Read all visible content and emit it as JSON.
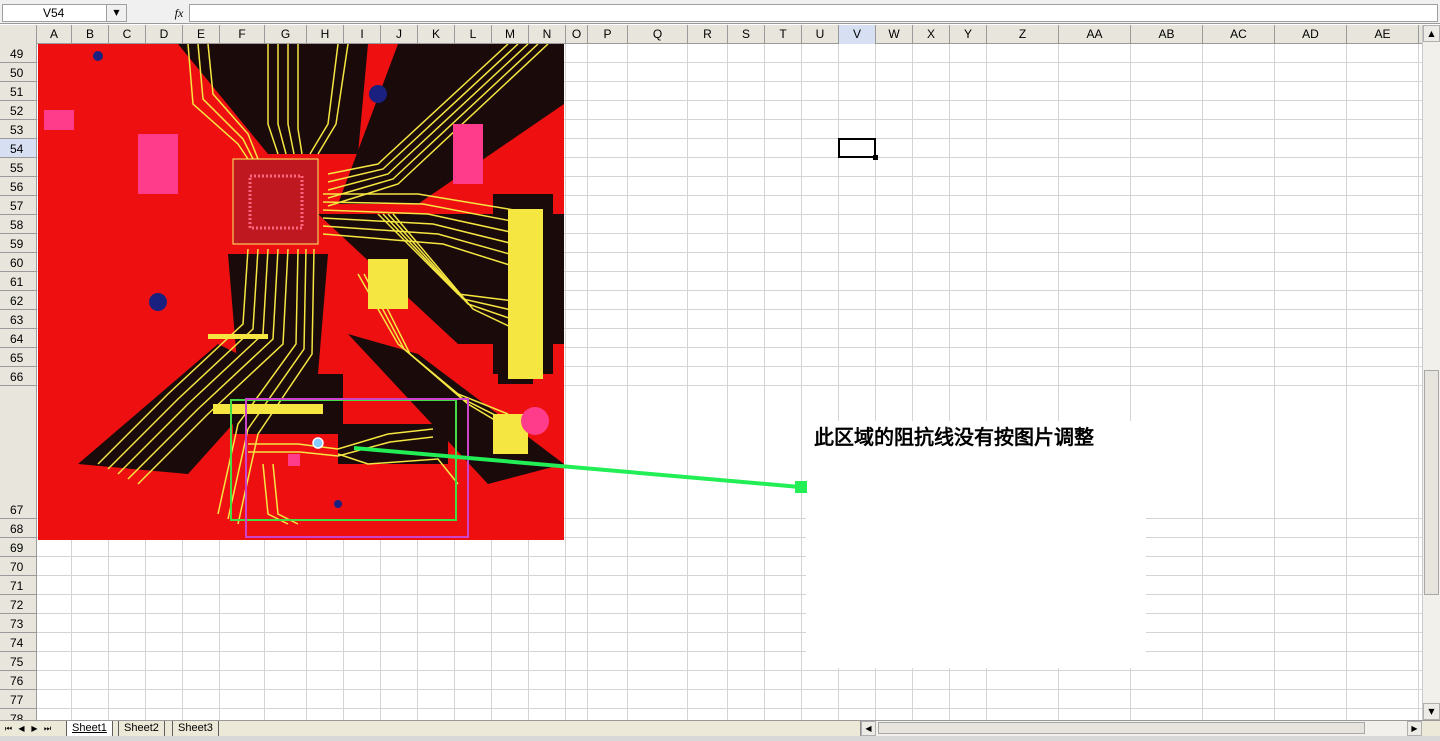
{
  "formula_bar": {
    "name_box": "V54",
    "formula_icon": "fx",
    "formula_value": ""
  },
  "columns": [
    "A",
    "B",
    "C",
    "D",
    "E",
    "F",
    "G",
    "H",
    "I",
    "J",
    "K",
    "L",
    "M",
    "N",
    "O",
    "P",
    "Q",
    "R",
    "S",
    "T",
    "U",
    "V",
    "W",
    "X",
    "Y",
    "Z",
    "AA",
    "AB",
    "AC",
    "AD",
    "AE"
  ],
  "active_column": "V",
  "rows": [
    "49",
    "50",
    "51",
    "52",
    "53",
    "54",
    "55",
    "56",
    "57",
    "58",
    "59",
    "60",
    "61",
    "62",
    "63",
    "64",
    "65",
    "66",
    "67",
    "68",
    "69",
    "70",
    "71",
    "72",
    "73",
    "74",
    "75",
    "76",
    "77",
    "78"
  ],
  "active_row": "54",
  "annotation": {
    "text": "此区域的阻抗线没有按图片调整",
    "arrow_color": "#22ee55"
  },
  "pcb_image": {
    "board_color": "#ee1010",
    "trace_color": "#f5e642",
    "highlight_box_colors": [
      "#44dd44",
      "#cc44cc"
    ]
  },
  "sheet_tabs": {
    "tabs": [
      "Sheet1",
      "Sheet2",
      "Sheet3"
    ],
    "active": "Sheet1"
  }
}
